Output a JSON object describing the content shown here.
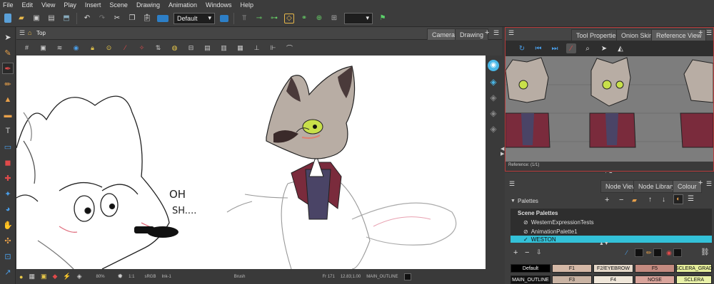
{
  "menu": [
    "File",
    "Edit",
    "View",
    "Play",
    "Insert",
    "Scene",
    "Drawing",
    "Animation",
    "Windows",
    "Help"
  ],
  "toolbar": {
    "workspace_select": "Default"
  },
  "viewport": {
    "breadcrumb": "Top",
    "tabs": [
      "Camera",
      "Drawing"
    ],
    "active_tab": "Camera",
    "lettering_line1": "OH",
    "lettering_line2": "SH...."
  },
  "status": {
    "zoom": "80%",
    "frame_ratio": "1:1",
    "color_space": "sRGB",
    "ink": "Ink-1",
    "tool": "Brush",
    "frame": "Fr 171",
    "coords": "12.83;1.00",
    "layer": "MAIN_OUTLINE"
  },
  "reference_panel": {
    "tabs": [
      "Tool Properties",
      "Onion Skin",
      "Reference View"
    ],
    "active_tab": "Reference View",
    "footer": "Reference: (1/1)"
  },
  "colour_panel": {
    "tabs": [
      "Node View",
      "Node Library",
      "Colour"
    ],
    "active_tab": "Colour",
    "palettes_label": "Palettes",
    "scene_palettes_header": "Scene Palettes",
    "palettes": [
      "WesternExpressionTests",
      "AnimationPalette1",
      "WESTON"
    ],
    "selected_palette": "WESTON",
    "swatches_row1": [
      {
        "label": "Default",
        "color": "#000000",
        "text_color": "#ffffff"
      },
      {
        "label": "F1",
        "color": "#d4b8a6",
        "text_color": "#111111"
      },
      {
        "label": "F2/EYEBROW",
        "color": "#e6d9ca",
        "text_color": "#111111"
      },
      {
        "label": "F5",
        "color": "#c48b80",
        "text_color": "#111111"
      },
      {
        "label": "SCLERA_GRAD",
        "color": "#e4ec9a",
        "text_color": "#111111"
      }
    ],
    "swatches_row2": [
      {
        "label": "MAIN_OUTLINE",
        "color": "#111111",
        "text_color": "#ffffff"
      },
      {
        "label": "F3",
        "color": "#c9b3a3",
        "text_color": "#111111"
      },
      {
        "label": "F4",
        "color": "#efe6d9",
        "text_color": "#111111"
      },
      {
        "label": "NOSE",
        "color": "#d9a49b",
        "text_color": "#111111"
      },
      {
        "label": "SCLERA",
        "color": "#e9f1a8",
        "text_color": "#111111"
      }
    ]
  },
  "colors": {
    "accent_selection": "#33c1d8",
    "panel_border_active": "#b83a3a",
    "jacket": "#7a2b3c",
    "fur_grey": "#b8ada4",
    "eye_green": "#c8e04a"
  }
}
